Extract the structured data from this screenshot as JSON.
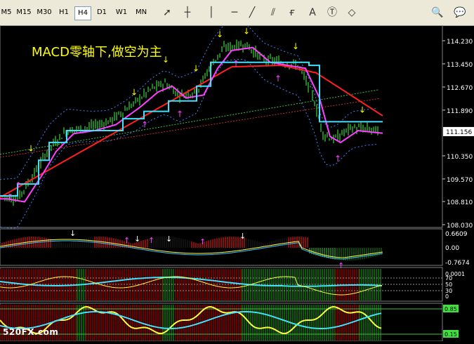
{
  "toolbar": {
    "timeframes": [
      "M5",
      "M15",
      "M30",
      "H1",
      "H4",
      "D1",
      "W1",
      "MN"
    ],
    "active": "H4",
    "tools": [
      "cursor-arrow-icon",
      "crosshair-icon",
      "vertical-line-icon",
      "horizontal-line-icon",
      "trendline-icon",
      "channel-icon",
      "fibonacci-icon",
      "text-icon",
      "text-label-icon",
      "shapes-dropdown-icon",
      "zoom-icon",
      "chat-icon"
    ]
  },
  "chart": {
    "headline": "MACD零轴下,做空为主",
    "price_axis": [
      "114.230",
      "113.450",
      "112.670",
      "111.890",
      "111.156",
      "110.350",
      "109.570",
      "108.810",
      "108.030"
    ],
    "current_price": "111.156",
    "macd_axis": [
      "0.6609",
      "0.00",
      "-0.7674"
    ],
    "ind2_axis": [
      "0.0001",
      "70",
      "50",
      "30",
      "0"
    ],
    "ind3_axis": [
      "0.85",
      "0.15"
    ],
    "colors": {
      "ma_red": "#ff2020",
      "ma_magenta": "#ff40ff",
      "line_cyan": "#40e0ff",
      "candle": "#40ff40",
      "arrow_up": "#ff40ff",
      "arrow_down": "#ffff00",
      "dark_red": "#6a0000",
      "dark_green": "#0a5a0a"
    }
  },
  "watermark": "520FX.com"
}
